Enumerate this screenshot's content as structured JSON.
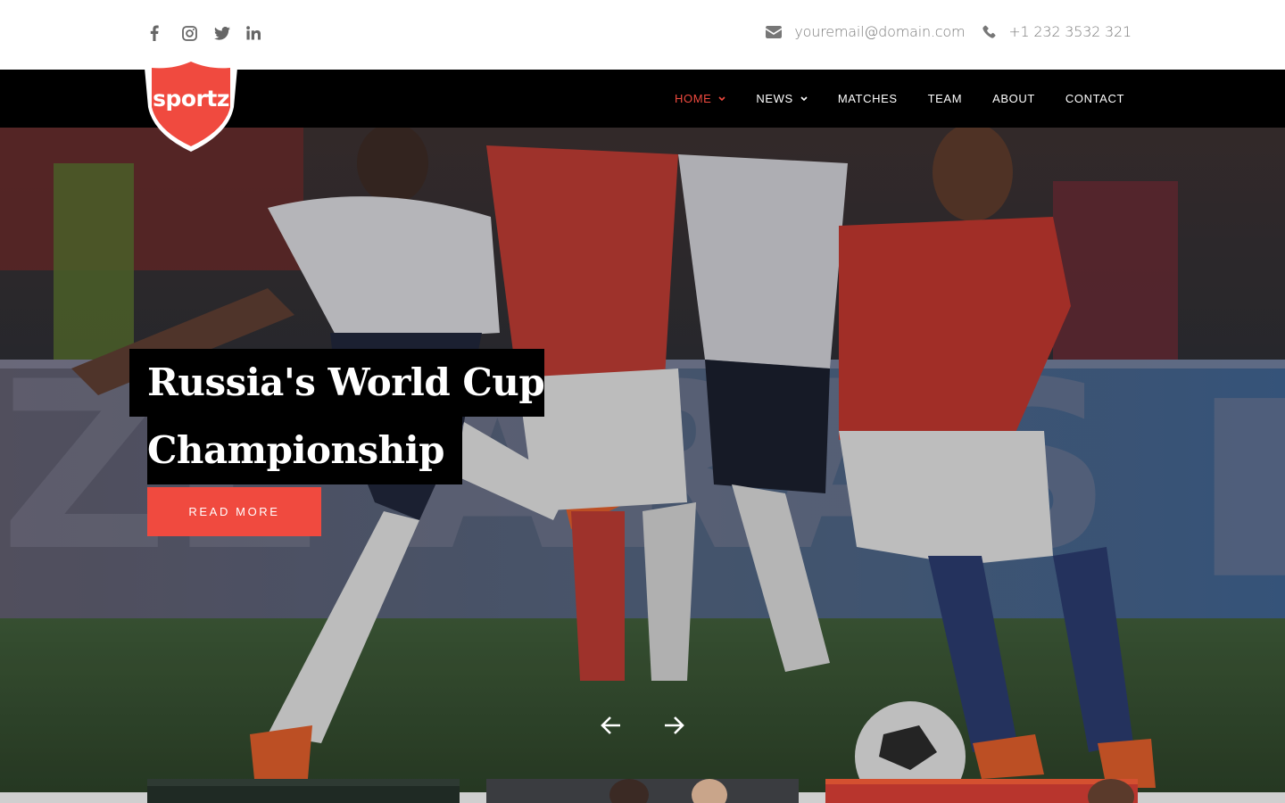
{
  "social": {
    "icons": [
      "facebook-icon",
      "instagram-icon",
      "twitter-icon",
      "linkedin-icon"
    ]
  },
  "contact": {
    "email": "youremail@domain.com",
    "phone": "+1 232 3532 321"
  },
  "brand": {
    "logo_text": "sportz",
    "accent": "#f04a3f"
  },
  "nav": {
    "items": [
      {
        "label": "HOME",
        "dropdown": true,
        "active": true
      },
      {
        "label": "NEWS",
        "dropdown": true,
        "active": false
      },
      {
        "label": "MATCHES",
        "dropdown": false,
        "active": false
      },
      {
        "label": "TEAM",
        "dropdown": false,
        "active": false
      },
      {
        "label": "ABOUT",
        "dropdown": false,
        "active": false
      },
      {
        "label": "CONTACT",
        "dropdown": false,
        "active": false
      }
    ]
  },
  "hero": {
    "title_line1": "Russia's World Cup",
    "title_line2": "Championship",
    "cta": "READ MORE"
  }
}
